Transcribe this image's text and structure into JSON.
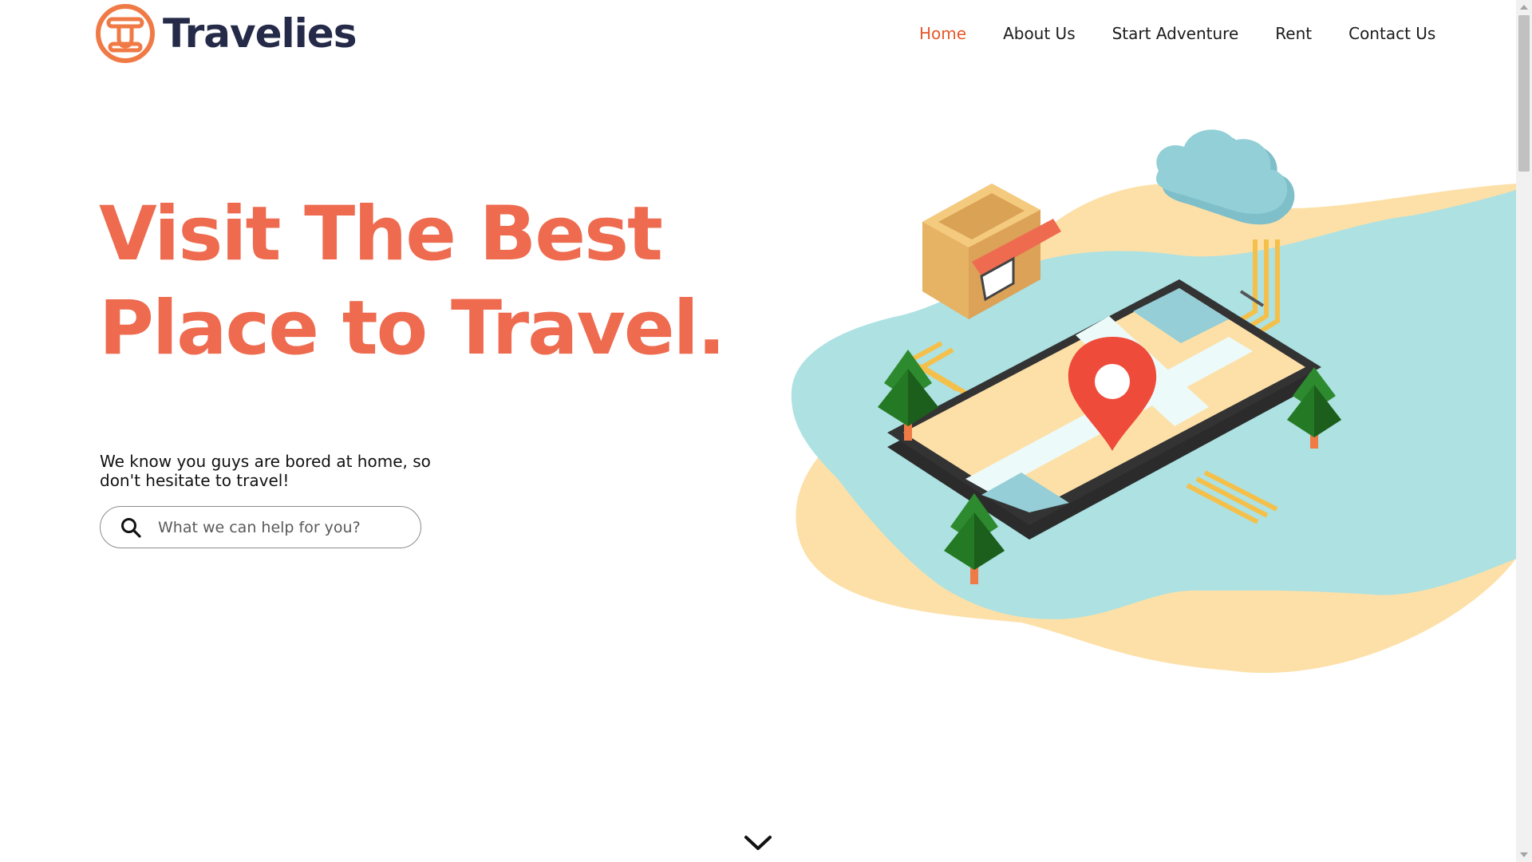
{
  "brand": {
    "name": "Travelies"
  },
  "nav": {
    "items": [
      {
        "label": "Home",
        "active": true
      },
      {
        "label": "About Us",
        "active": false
      },
      {
        "label": "Start Adventure",
        "active": false
      },
      {
        "label": "Rent",
        "active": false
      },
      {
        "label": "Contact Us",
        "active": false
      }
    ]
  },
  "hero": {
    "title_line1": "Visit The Best",
    "title_line2": "Place to Travel.",
    "subtitle": "We know you guys are bored at home, so don't hesitate to travel!"
  },
  "search": {
    "placeholder": "What we can help for you?",
    "value": ""
  },
  "icons": {
    "logo": "travelies-logo-icon",
    "search": "search-icon",
    "scroll_down": "chevron-down-icon"
  },
  "colors": {
    "accent": "#ee6b50",
    "nav_active": "#e5582a",
    "brand_text": "#252a48",
    "water": "#ade1e2",
    "sand": "#fde0a8"
  }
}
